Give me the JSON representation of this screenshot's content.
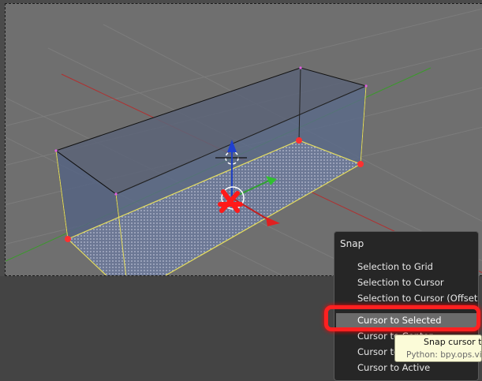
{
  "snap_menu": {
    "title": "Snap",
    "items": [
      {
        "label": "Selection to Grid"
      },
      {
        "label": "Selection to Cursor"
      },
      {
        "label": "Selection to Cursor (Offset)"
      },
      {
        "label": "Cursor to Selected",
        "highlighted": true
      },
      {
        "label": "Cursor to Center"
      },
      {
        "label": "Cursor to Grid"
      },
      {
        "label": "Cursor to Active"
      }
    ]
  },
  "tooltip": {
    "title": "Snap cursor to",
    "python": "Python: bpy.ops.view"
  },
  "colors": {
    "viewport_bg": "#6f6f6f",
    "menu_bg": "#262626",
    "menu_highlight": "#6b6b6b",
    "annotation_red": "#ff2020",
    "x_axis": "#c23030",
    "y_axis": "#3a9a2a",
    "selected_edges": "#e8e060"
  }
}
